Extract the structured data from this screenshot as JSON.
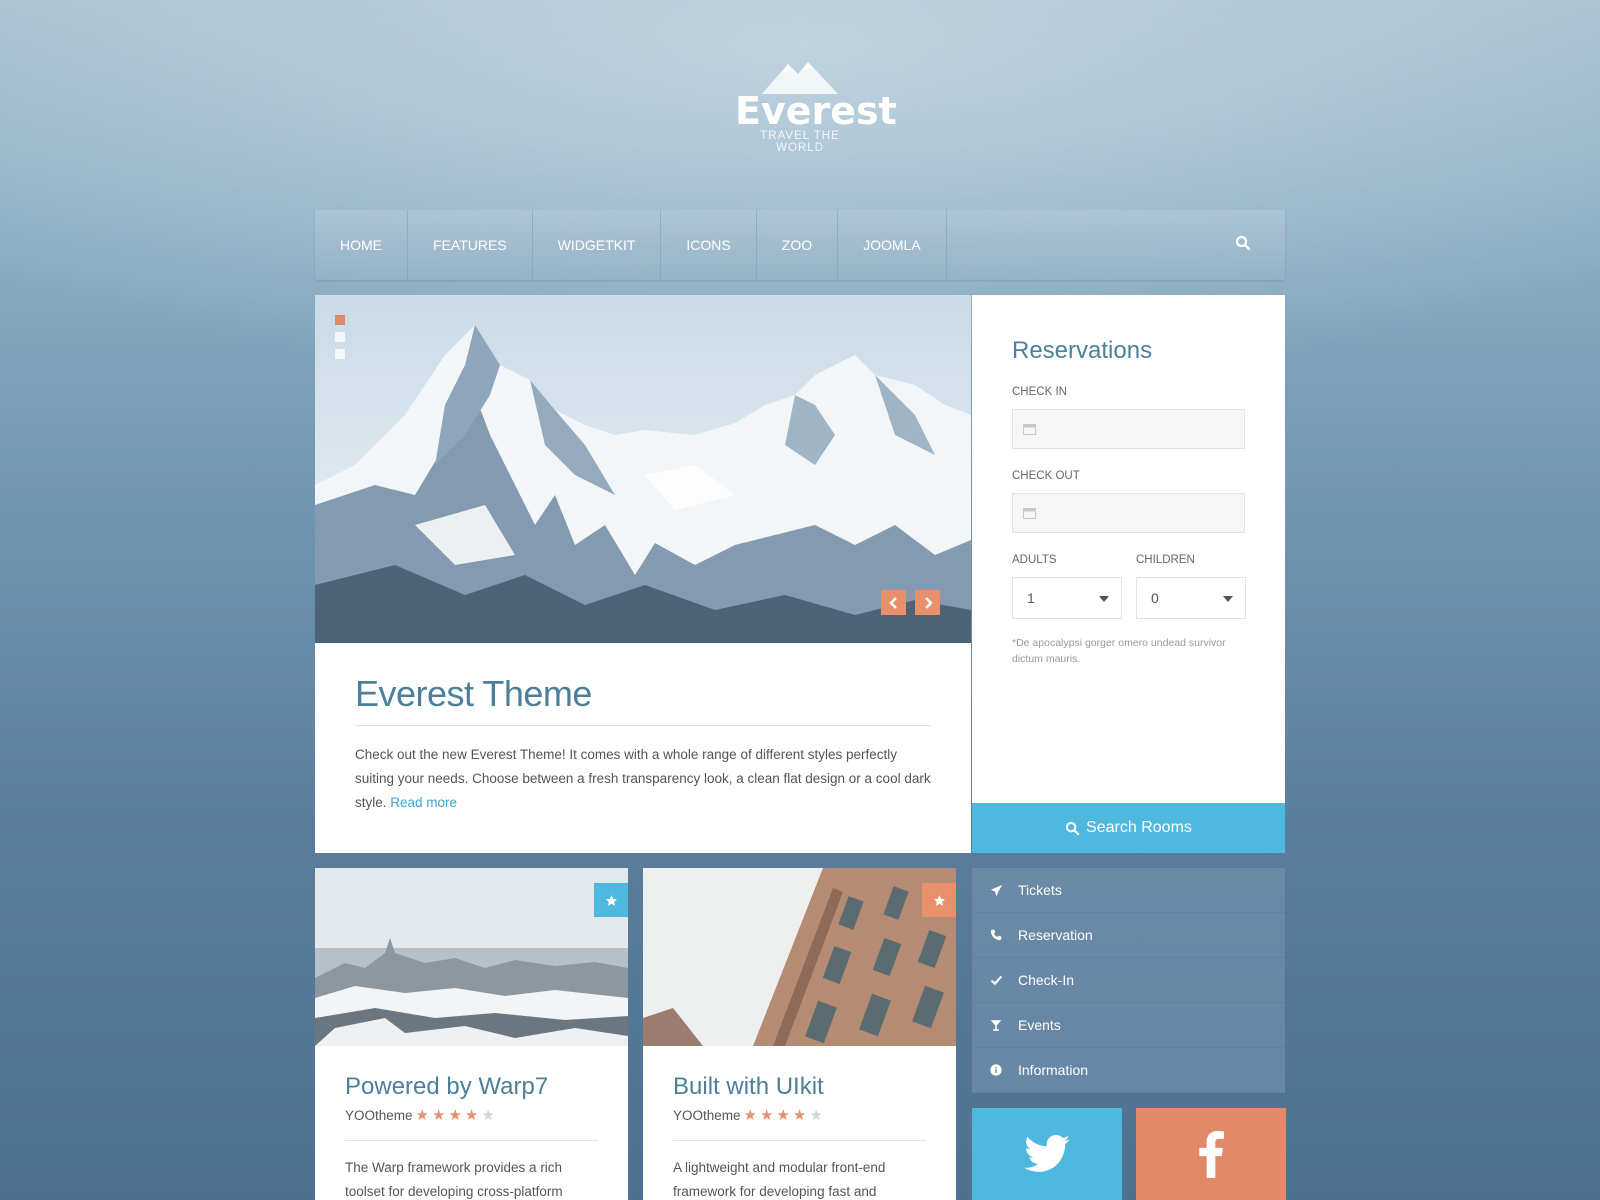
{
  "logo": {
    "name": "Everest",
    "tagline": "TRAVEL THE WORLD"
  },
  "nav": {
    "items": [
      "HOME",
      "FEATURES",
      "WIDGETKIT",
      "ICONS",
      "ZOO",
      "JOOMLA"
    ],
    "search_icon": "search-icon"
  },
  "slider": {
    "slides": 3,
    "active_slide": 1
  },
  "intro": {
    "title": "Everest Theme",
    "body": "Check out the new Everest Theme! It comes with a whole range of different styles perfectly suiting your needs. Choose between a fresh transparency look, a clean flat design or a cool dark style.",
    "link": "Read more"
  },
  "reservation": {
    "title": "Reservations",
    "check_in_label": "CHECK IN",
    "check_out_label": "CHECK OUT",
    "adults_label": "ADULTS",
    "adults_value": "1",
    "children_label": "CHILDREN",
    "children_value": "0",
    "note": "*De apocalypsi gorger omero undead survivor dictum mauris.",
    "button": "Search Rooms"
  },
  "cards": [
    {
      "title": "Powered by Warp7",
      "author": "YOOtheme",
      "rating": 4,
      "rating_max": 5,
      "body": "The Warp framework provides a rich toolset for developing cross-platform",
      "badge_color": "#4fb8df"
    },
    {
      "title": "Built with UIkit",
      "author": "YOOtheme",
      "rating": 4,
      "rating_max": 5,
      "body": "A lightweight and modular front-end framework for developing fast and",
      "badge_color": "#e8906c"
    }
  ],
  "side_menu": [
    {
      "label": "Tickets",
      "icon": "plane-icon"
    },
    {
      "label": "Reservation",
      "icon": "phone-icon"
    },
    {
      "label": "Check-In",
      "icon": "check-icon"
    },
    {
      "label": "Events",
      "icon": "cocktail-icon"
    },
    {
      "label": "Information",
      "icon": "info-icon"
    }
  ],
  "social": [
    {
      "name": "twitter",
      "icon": "twitter-icon",
      "color": "#4fb8df"
    },
    {
      "name": "facebook",
      "icon": "facebook-icon",
      "color": "#e08a6a"
    }
  ],
  "colors": {
    "accent": "#e8906c",
    "blue": "#4fb8df",
    "heading": "#4c7f99"
  }
}
